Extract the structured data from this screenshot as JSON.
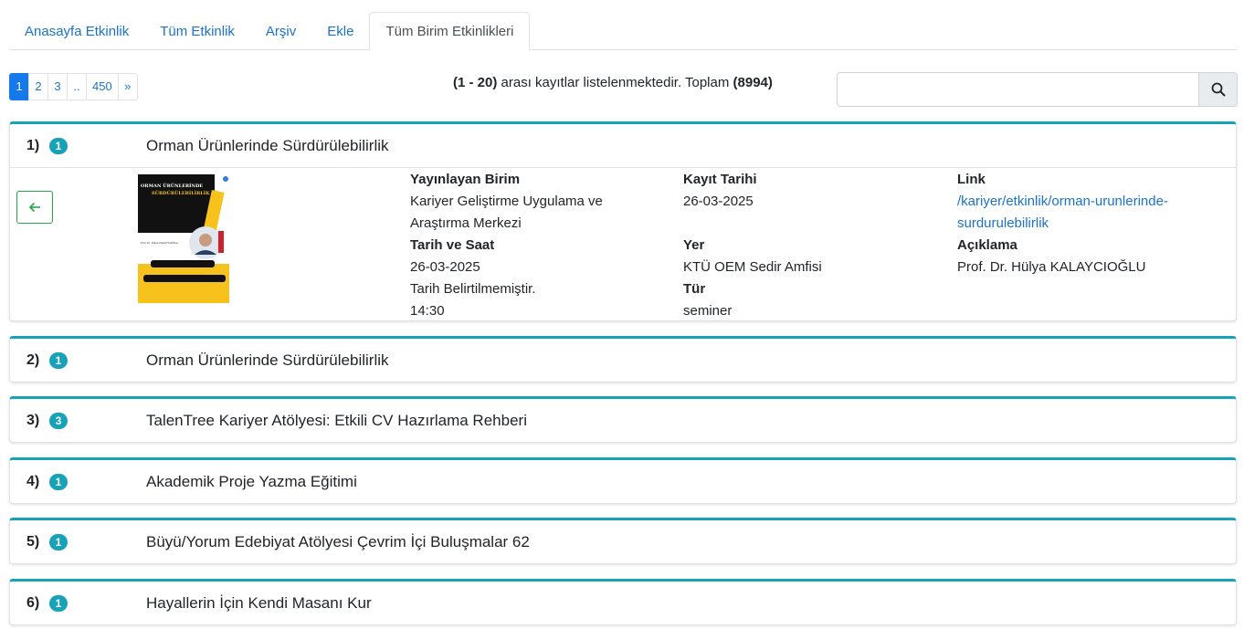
{
  "tabs": [
    {
      "label": "Anasayfa Etkinlik"
    },
    {
      "label": "Tüm Etkinlik"
    },
    {
      "label": "Arşiv"
    },
    {
      "label": "Ekle"
    },
    {
      "label": "Tüm Birim Etkinlikleri",
      "active": true
    }
  ],
  "pagination": [
    "1",
    "2",
    "3",
    "..",
    "450",
    "»"
  ],
  "summary": {
    "range": "(1 - 20)",
    "text": " arası kayıtlar listelenmektedir. Toplam ",
    "total": "(8994)"
  },
  "search": {
    "value": "",
    "placeholder": ""
  },
  "poster": {
    "title_line1": "ORMAN ÜRÜNLERİNDE",
    "title_line2": "SÜRDÜRÜLEBİLİRLİK",
    "speaker": "Prof. Dr. Hülya KALAYCIOĞLU"
  },
  "events": [
    {
      "num": "1)",
      "count": "1",
      "title": "Orman Ürünlerinde Sürdürülebilirlik"
    },
    {
      "num": "2)",
      "count": "1",
      "title": "Orman Ürünlerinde Sürdürülebilirlik"
    },
    {
      "num": "3)",
      "count": "3",
      "title": "TalenTree Kariyer Atölyesi: Etkili CV Hazırlama Rehberi"
    },
    {
      "num": "4)",
      "count": "1",
      "title": "Akademik Proje Yazma Eğitimi"
    },
    {
      "num": "5)",
      "count": "1",
      "title": "Büyü/Yorum Edebiyat Atölyesi Çevrim İçi Buluşmalar 62"
    },
    {
      "num": "6)",
      "count": "1",
      "title": "Hayallerin İçin Kendi Masanı Kur"
    }
  ],
  "detail": {
    "publisher_label": "Yayınlayan Birim",
    "publisher_line1": "Kariyer Geliştirme Uygulama ve",
    "publisher_line2": "Araştırma Merkezi",
    "datetime_label": "Tarih ve Saat",
    "date": "26-03-2025",
    "date_note": "Tarih Belirtilmemiştir.",
    "time": "14:30",
    "reg_label": "Kayıt Tarihi",
    "reg_date": "26-03-2025",
    "place_label": "Yer",
    "place": "KTÜ OEM Sedir Amfisi",
    "type_label": "Tür",
    "type": "seminer",
    "link_label": "Link",
    "link_line1": "/kariyer/etkinlik/orman-urunlerinde-",
    "link_line2": "surdurulebilirlik",
    "desc_label": "Açıklama",
    "desc": "Prof. Dr. Hülya KALAYCIOĞLU"
  },
  "colors": {
    "accent": "#17a2b8",
    "link": "#1a73c8",
    "active_page": "#1479e9",
    "back_button": "#28a745"
  }
}
